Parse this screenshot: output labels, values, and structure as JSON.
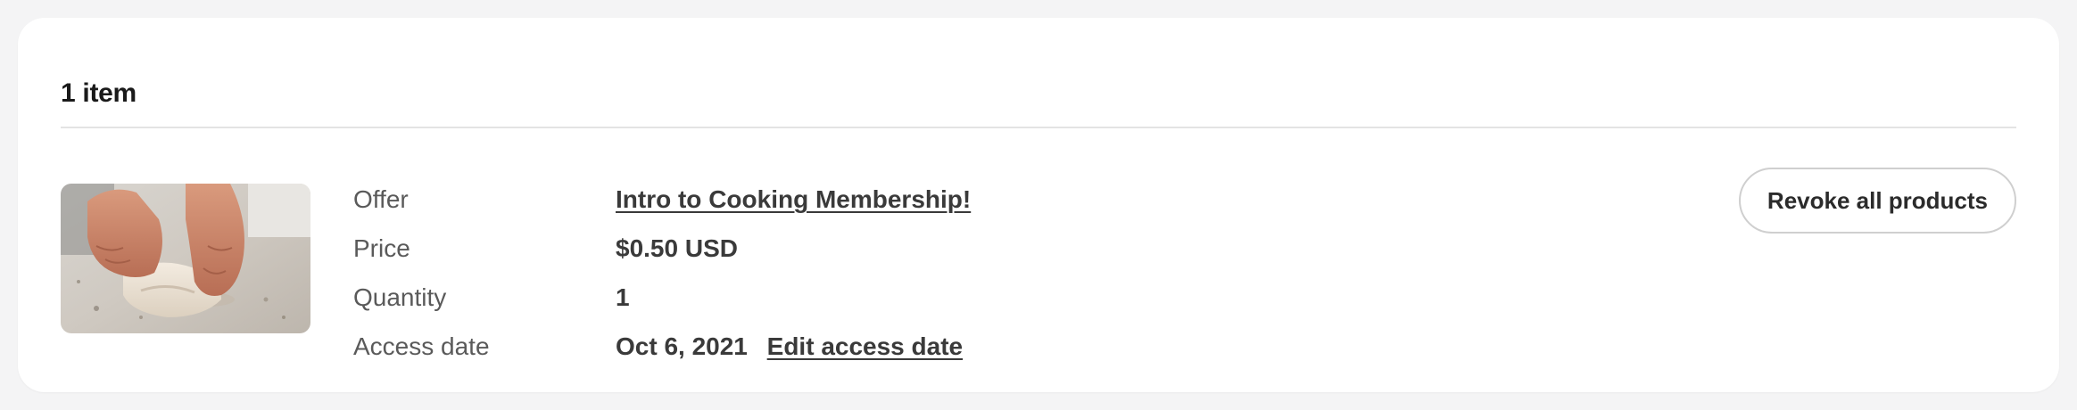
{
  "summary": {
    "item_count": "1 item"
  },
  "item": {
    "image_alt": "Hands kneading dough",
    "offer_label": "Offer",
    "offer_value": "Intro to Cooking Membership!",
    "price_label": "Price",
    "price_value": "$0.50 USD",
    "quantity_label": "Quantity",
    "quantity_value": "1",
    "access_label": "Access date",
    "access_value": "Oct 6, 2021",
    "edit_access_label": "Edit access date"
  },
  "actions": {
    "revoke_label": "Revoke all products"
  },
  "colors": {
    "card_background": "#ffffff",
    "page_background": "#f4f4f5",
    "divider": "#e3e3e3",
    "button_border": "#cfcfcf"
  }
}
